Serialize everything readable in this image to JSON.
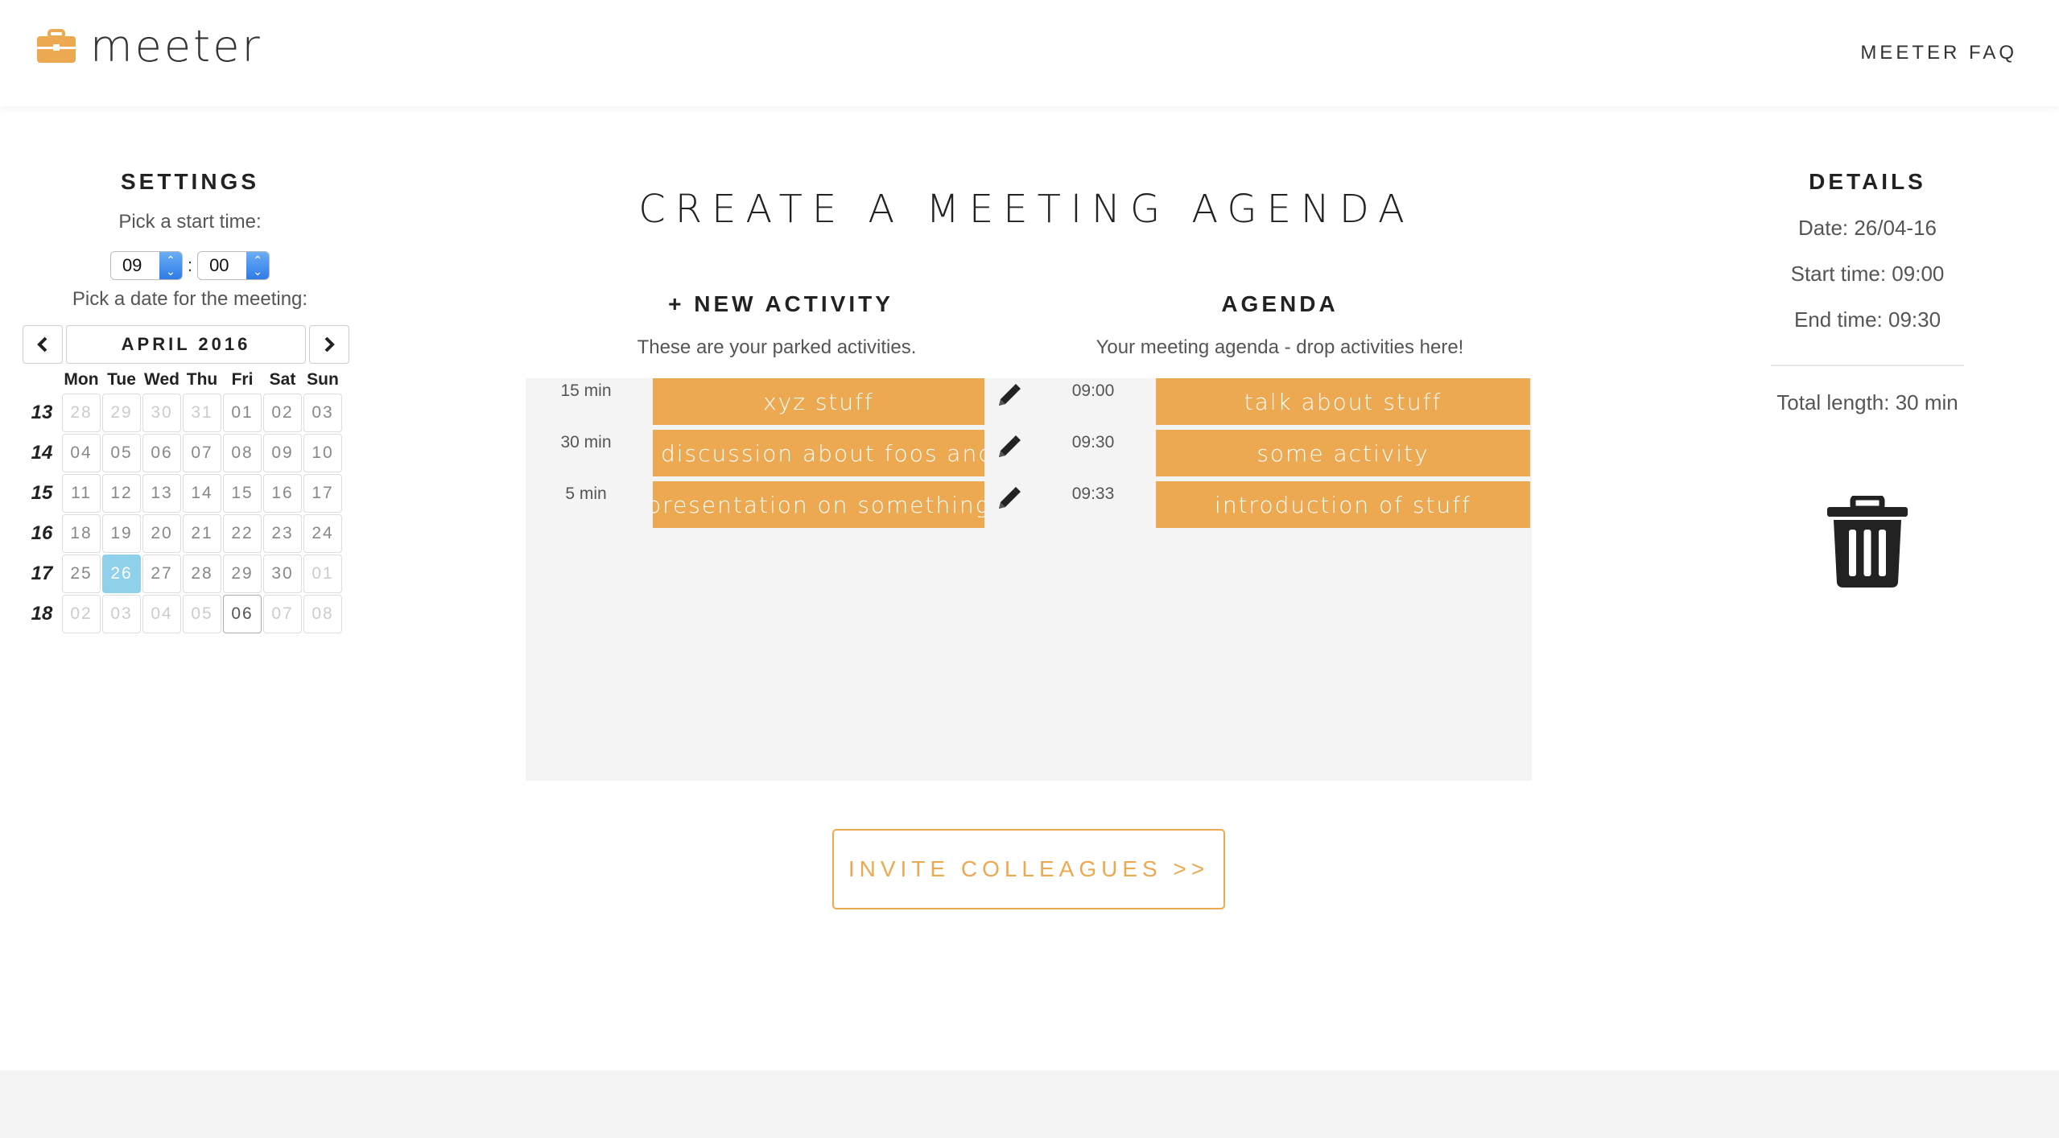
{
  "brand": {
    "name": "meeter",
    "accent": "#eda952"
  },
  "nav": {
    "faq": "MEETER FAQ"
  },
  "settings": {
    "title": "SETTINGS",
    "pick_start": "Pick a start time:",
    "hour": "09",
    "minute": "00",
    "pick_date": "Pick a date for the meeting:"
  },
  "calendar": {
    "month_label": "APRIL 2016",
    "weekdays": [
      "Mon",
      "Tue",
      "Wed",
      "Thu",
      "Fri",
      "Sat",
      "Sun"
    ],
    "weeks": [
      {
        "num": "13",
        "days": [
          [
            "28",
            "other"
          ],
          [
            "29",
            "other"
          ],
          [
            "30",
            "other"
          ],
          [
            "31",
            "other"
          ],
          [
            "01",
            ""
          ],
          [
            "02",
            ""
          ],
          [
            "03",
            ""
          ]
        ]
      },
      {
        "num": "14",
        "days": [
          [
            "04",
            ""
          ],
          [
            "05",
            ""
          ],
          [
            "06",
            ""
          ],
          [
            "07",
            ""
          ],
          [
            "08",
            ""
          ],
          [
            "09",
            ""
          ],
          [
            "10",
            ""
          ]
        ]
      },
      {
        "num": "15",
        "days": [
          [
            "11",
            ""
          ],
          [
            "12",
            ""
          ],
          [
            "13",
            ""
          ],
          [
            "14",
            ""
          ],
          [
            "15",
            ""
          ],
          [
            "16",
            ""
          ],
          [
            "17",
            ""
          ]
        ]
      },
      {
        "num": "16",
        "days": [
          [
            "18",
            ""
          ],
          [
            "19",
            ""
          ],
          [
            "20",
            ""
          ],
          [
            "21",
            ""
          ],
          [
            "22",
            ""
          ],
          [
            "23",
            ""
          ],
          [
            "24",
            ""
          ]
        ]
      },
      {
        "num": "17",
        "days": [
          [
            "25",
            ""
          ],
          [
            "26",
            "selected"
          ],
          [
            "27",
            ""
          ],
          [
            "28",
            ""
          ],
          [
            "29",
            ""
          ],
          [
            "30",
            ""
          ],
          [
            "01",
            "other"
          ]
        ]
      },
      {
        "num": "18",
        "days": [
          [
            "02",
            "other"
          ],
          [
            "03",
            "other"
          ],
          [
            "04",
            "other"
          ],
          [
            "05",
            "other"
          ],
          [
            "06",
            "today"
          ],
          [
            "07",
            "other"
          ],
          [
            "08",
            "other"
          ]
        ]
      }
    ]
  },
  "main": {
    "title": "CREATE A MEETING AGENDA",
    "new_activity": {
      "plus": "+",
      "label": "NEW ACTIVITY",
      "subtitle": "These are your parked activities."
    },
    "agenda": {
      "label": "AGENDA",
      "subtitle": "Your meeting agenda - drop activities here!"
    },
    "rows": [
      {
        "duration": "15 min",
        "activity": "xyz stuff",
        "time": "09:00",
        "agenda_item": "talk about stuff"
      },
      {
        "duration": "30 min",
        "activity": "discussion about foos and ba",
        "time": "09:30",
        "agenda_item": "some activity"
      },
      {
        "duration": "5 min",
        "activity": "presentation on something",
        "time": "09:33",
        "agenda_item": "introduction of stuff"
      }
    ],
    "invite": "INVITE COLLEAGUES >>"
  },
  "details": {
    "title": "DETAILS",
    "date": "Date: 26/04-16",
    "start": "Start time: 09:00",
    "end": "End time: 09:30",
    "total": "Total length: 30 min"
  }
}
